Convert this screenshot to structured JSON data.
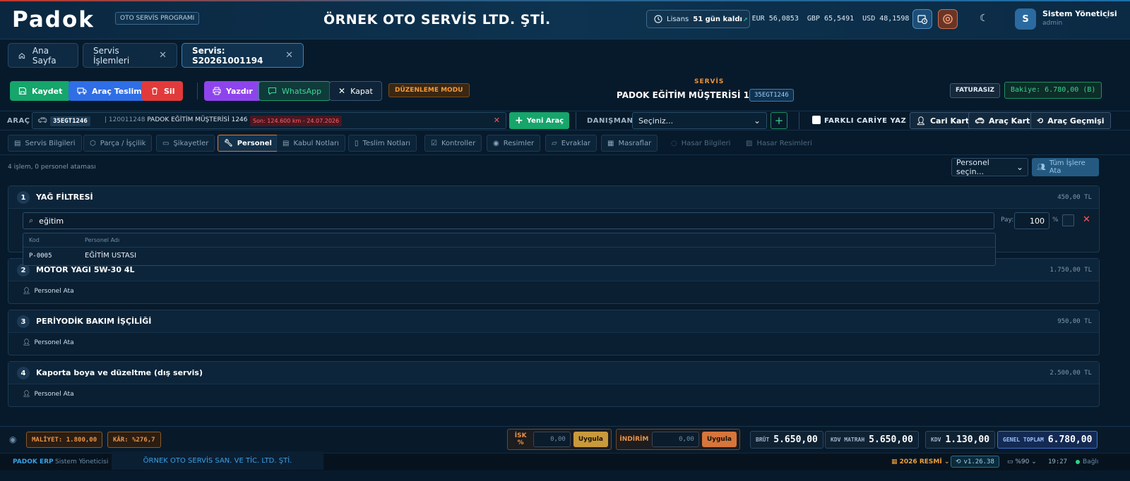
{
  "header": {
    "logo": "Padok",
    "badge": "OTO SERVİS PROGRAMI",
    "company": "ÖRNEK OTO SERVİS LTD. ŞTİ.",
    "license_label": "Lisans",
    "license_value": "51 gün kaldı",
    "rates": "EUR 56,0853  GBP 65,5491  USD 48,1598",
    "user_initial": "S",
    "user_name": "Sistem Yöneticisi",
    "user_role": "admin"
  },
  "tabs": [
    {
      "label": "Ana Sayfa"
    },
    {
      "label": "Servis İşlemleri"
    },
    {
      "label": "Servis: S20261001194"
    }
  ],
  "toolbar": {
    "save": "Kaydet",
    "deliver": "Araç Teslim",
    "delete": "Sil",
    "print": "Yazdır",
    "whatsapp": "WhatsApp",
    "close": "Kapat",
    "mode": "DÜZENLEME MODU",
    "service_label": "SERVİS",
    "customer": "PADOK EĞİTİM MÜŞTERİSİ 1246",
    "plate": "35EGT1246",
    "invoice": "FATURASIZ",
    "balance": "Bakiye: 6.780,00 (B)"
  },
  "vehicle": {
    "label": "ARAÇ",
    "plate": "35EGT1246",
    "code": "120011248",
    "name": "PADOK EĞİTİM MÜŞTERİSİ 1246",
    "last": "Son: 124.600 km - 24.07.2026",
    "new_vehicle": "Yeni Araç",
    "advisor_label": "DANIŞMAN",
    "advisor_value": "Seçiniz...",
    "other_account": "FARKLI CARİYE YAZ",
    "account_card": "Cari Kart",
    "vehicle_card": "Araç Kart",
    "vehicle_history": "Araç Geçmişi"
  },
  "subtabs": [
    "Servis Bilgileri",
    "Parça / İşçilik",
    "Şikayetler",
    "Personel",
    "Kabul Notları",
    "Teslim Notları",
    "Kontroller",
    "Resimler",
    "Evraklar",
    "Masraflar",
    "Hasar Bilgileri",
    "Hasar Resimleri"
  ],
  "summary": {
    "info": "4 işlem, 0 personel ataması",
    "personnel_select": "Personel seçin...",
    "assign_all": "Tüm İşlere Ata"
  },
  "items": [
    {
      "no": "1",
      "title": "YAĞ FİLTRESİ",
      "price": "450,00 TL"
    },
    {
      "no": "2",
      "title": "MOTOR YAGI 5W-30 4L",
      "price": "1.750,00 TL"
    },
    {
      "no": "3",
      "title": "PERİYODİK BAKIM İŞÇİLİĞİ",
      "price": "950,00 TL"
    },
    {
      "no": "4",
      "title": "Kaporta boya ve düzeltme (dış servis)",
      "price": "2.500,00 TL"
    }
  ],
  "assign_label": "Personel Ata",
  "search": {
    "value": "eğitim",
    "share_label": "Pay:",
    "share_value": "100",
    "pct": "%",
    "col_code": "Kod",
    "col_name": "Personel Adı",
    "result_code": "P-0005",
    "result_name": "EĞİTİM USTASI"
  },
  "footer": {
    "cost": "MALİYET: 1.800,00",
    "profit": "KÂR: %276,7",
    "disc_pct_label": "İSK %",
    "disc_pct_value": "0,00",
    "apply": "Uygula",
    "disc_label": "İNDİRİM",
    "disc_value": "0,00",
    "brut_label": "BRÜT",
    "brut": "5.650,00",
    "kdvm_label": "KDV MATRAH",
    "kdvm": "5.650,00",
    "kdv_label": "KDV",
    "kdv": "1.130,00",
    "total_label": "GENEL TOPLAM",
    "total": "6.780,00"
  },
  "status": {
    "app": "PADOK ERP",
    "user": "Sistem Yöneticisi",
    "company": "ÖRNEK OTO SERVİS SAN. VE TİC. LTD. ŞTİ.",
    "period": "2026 RESMİ",
    "version": "v1.26.38",
    "zoom": "%90",
    "time": "19:27",
    "conn": "Bağlı"
  },
  "colors": {
    "green": "#16a56b",
    "blue": "#2f6ee5",
    "red": "#e23a3a",
    "purple": "#8e44ec",
    "orange": "#e07a35"
  }
}
